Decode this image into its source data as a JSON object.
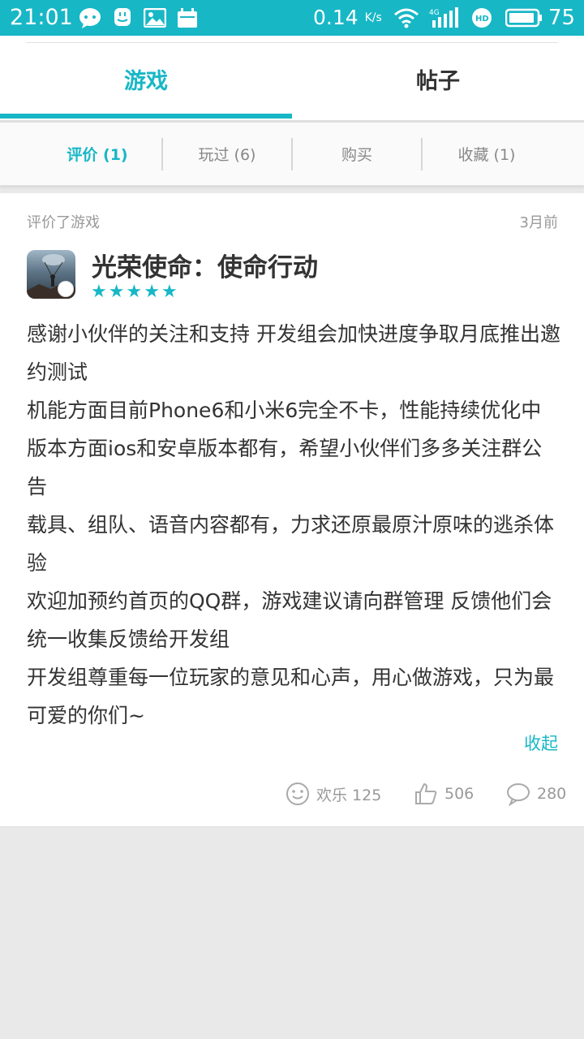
{
  "status_bar": {
    "time": "21:01",
    "net_speed": "0.14",
    "net_speed_unit": "K/s",
    "battery": "75"
  },
  "main_tabs": [
    {
      "label": "游戏",
      "active": true
    },
    {
      "label": "帖子",
      "active": false
    }
  ],
  "sub_tabs": [
    {
      "label": "评价 (1)",
      "active": true
    },
    {
      "label": "玩过 (6)",
      "active": false
    },
    {
      "label": "购买",
      "active": false
    },
    {
      "label": "收藏 (1)",
      "active": false
    }
  ],
  "review_card": {
    "action_text": "评价了游戏",
    "time_ago": "3月前",
    "game_title": "光荣使命：使命行动",
    "rating": 5,
    "content_lines": [
      "感谢小伙伴的关注和支持 开发组会加快进度争取月底推出邀约测试",
      "机能方面目前Phone6和小米6完全不卡，性能持续优化中",
      "版本方面ios和安卓版本都有，希望小伙伴们多多关注群公告",
      "载具、组队、语音内容都有，力求还原最原汁原味的逃杀体验",
      "欢迎加预约首页的QQ群，游戏建议请向群管理 反馈他们会统一收集反馈给开发组",
      "开发组尊重每一位玩家的意见和心声，用心做游戏，只为最可爱的你们~"
    ],
    "collapse_label": "收起",
    "fun_label": "欢乐 125",
    "likes": "506",
    "comments": "280"
  },
  "colors": {
    "accent": "#17b7c6"
  }
}
